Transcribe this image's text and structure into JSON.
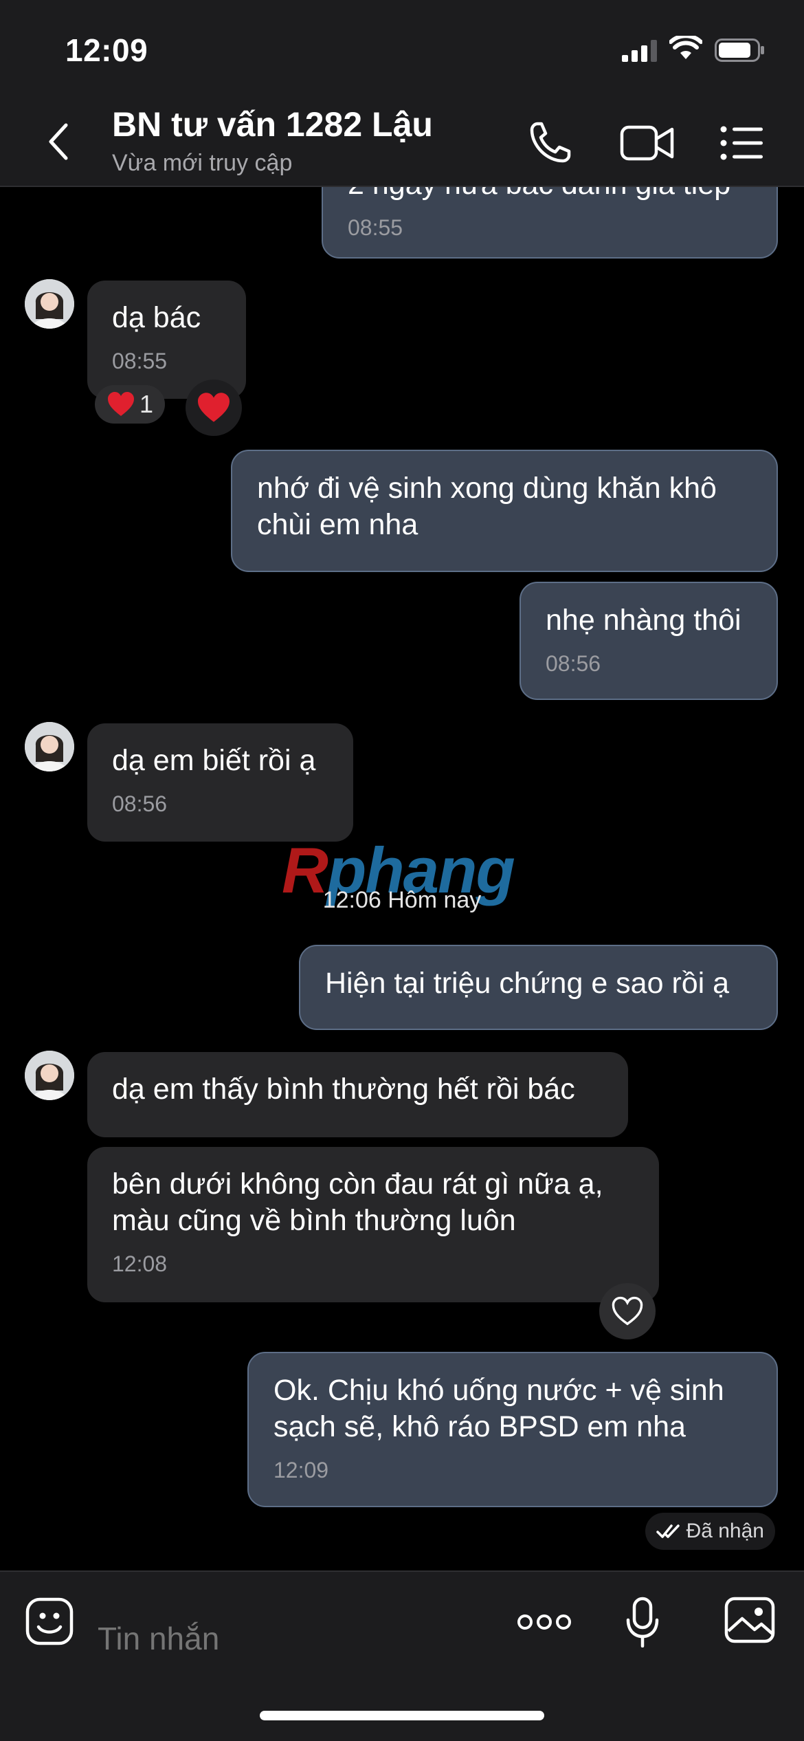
{
  "status": {
    "time": "12:09"
  },
  "header": {
    "title": "BN tư vấn 1282 Lậu",
    "subtitle": "Vừa mới truy cập"
  },
  "messages": {
    "m0": {
      "text": "2 ngày nữa bác đánh giá tiếp",
      "time": "08:55"
    },
    "m1": {
      "text": "dạ bác",
      "time": "08:55",
      "reaction_count": "1"
    },
    "m2": {
      "text": "nhớ đi vệ sinh xong dùng khăn khô\nchùi em nha"
    },
    "m3": {
      "text": "nhẹ nhàng thôi",
      "time": "08:56"
    },
    "m4": {
      "text": "dạ em biết rồi ạ",
      "time": "08:56"
    },
    "m5": {
      "text": "Hiện tại triệu chứng e sao rồi ạ"
    },
    "m6": {
      "text": "dạ em thấy bình thường hết rồi bác"
    },
    "m7": {
      "text": "bên dưới không còn đau rát gì nữa ạ,\nmàu cũng về bình thường luôn",
      "time": "12:08"
    },
    "m8": {
      "text": "Ok. Chịu khó uống nước + vệ sinh\nsạch sẽ, khô ráo BPSD em nha",
      "time": "12:09"
    }
  },
  "divider": {
    "time": "12:06 Hôm nay"
  },
  "watermark": {
    "first": "R",
    "rest": "phang"
  },
  "seen": {
    "label": "Đã nhận"
  },
  "composer": {
    "placeholder": "Tin nhắn"
  },
  "colors": {
    "incoming_bubble": "#272729",
    "outgoing_bubble": "#3b4453",
    "outgoing_border": "#5d6e87",
    "heart": "#e0202e"
  }
}
